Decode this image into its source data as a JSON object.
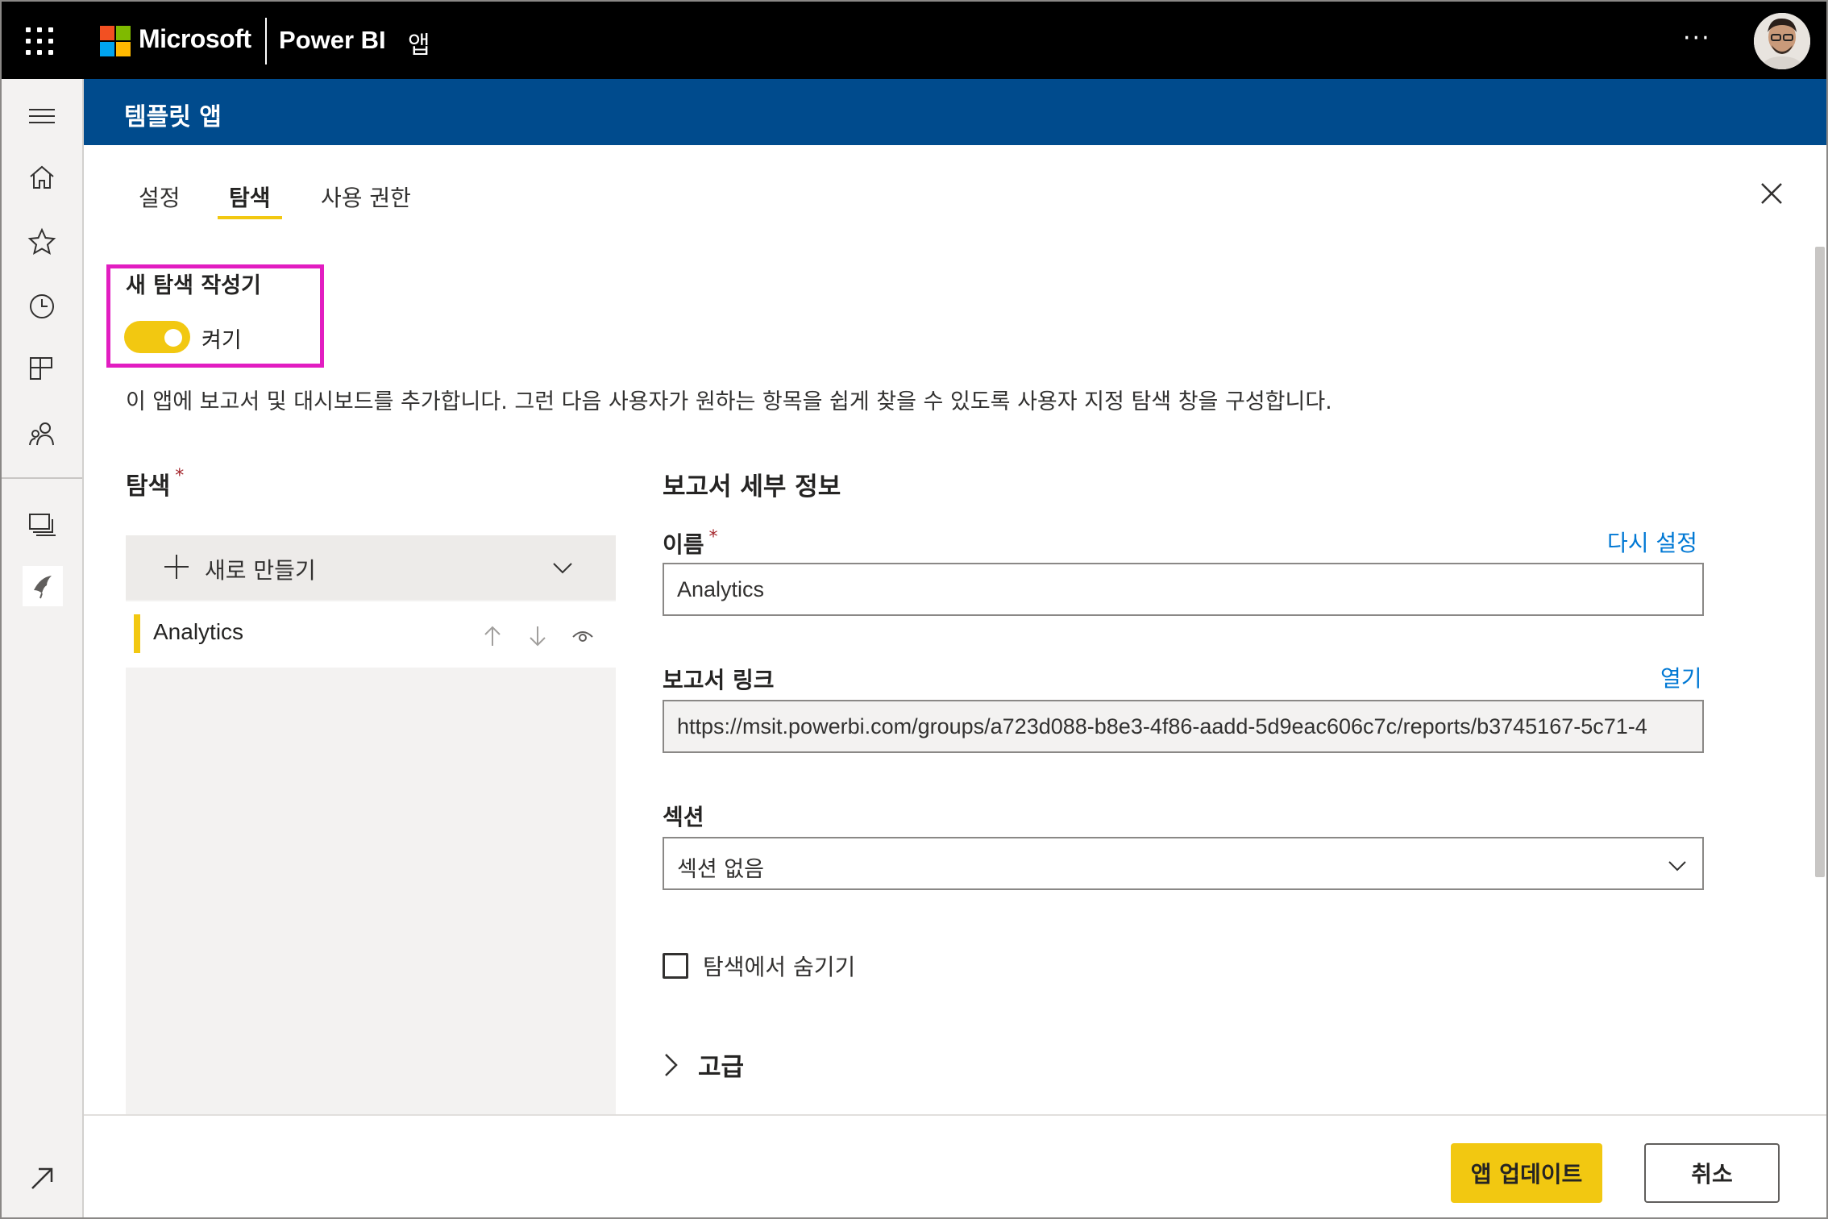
{
  "topbar": {
    "brand_company": "Microsoft",
    "brand_product": "Power BI",
    "brand_section": "앱",
    "more_label": "···"
  },
  "header": {
    "title": "템플릿 앱"
  },
  "tabs": [
    {
      "label": "설정",
      "selected": false
    },
    {
      "label": "탐색",
      "selected": true
    },
    {
      "label": "사용 권한",
      "selected": false
    }
  ],
  "new_nav_builder": {
    "title": "새 탐색 작성기",
    "toggle_label": "켜기",
    "toggle_on": true
  },
  "description": "이 앱에 보고서 및 대시보드를 추가합니다. 그런 다음 사용자가 원하는 항목을 쉽게 찾을 수 있도록 사용자 지정 탐색 창을 구성합니다.",
  "navigation": {
    "heading": "탐색",
    "required_mark": "*",
    "create_new_label": "새로 만들기",
    "items": [
      {
        "label": "Analytics",
        "selected": true
      }
    ]
  },
  "report_details": {
    "heading": "보고서 세부 정보",
    "name": {
      "label": "이름",
      "required_mark": "*",
      "reset_link": "다시 설정",
      "value": "Analytics"
    },
    "report_link": {
      "label": "보고서 링크",
      "open_link": "열기",
      "value": "https://msit.powerbi.com/groups/a723d088-b8e3-4f86-aadd-5d9eac606c7c/reports/b3745167-5c71-4"
    },
    "section": {
      "label": "섹션",
      "value": "섹션 없음"
    },
    "hide_checkbox": {
      "label": "탐색에서 숨기기",
      "checked": false
    },
    "advanced_label": "고급"
  },
  "footer": {
    "update_button": "앱 업데이트",
    "cancel_button": "취소"
  },
  "colors": {
    "accent_yellow": "#f2c811",
    "header_blue": "#004b8d",
    "link_blue": "#0078d4",
    "highlight_magenta": "#e21dc1"
  }
}
